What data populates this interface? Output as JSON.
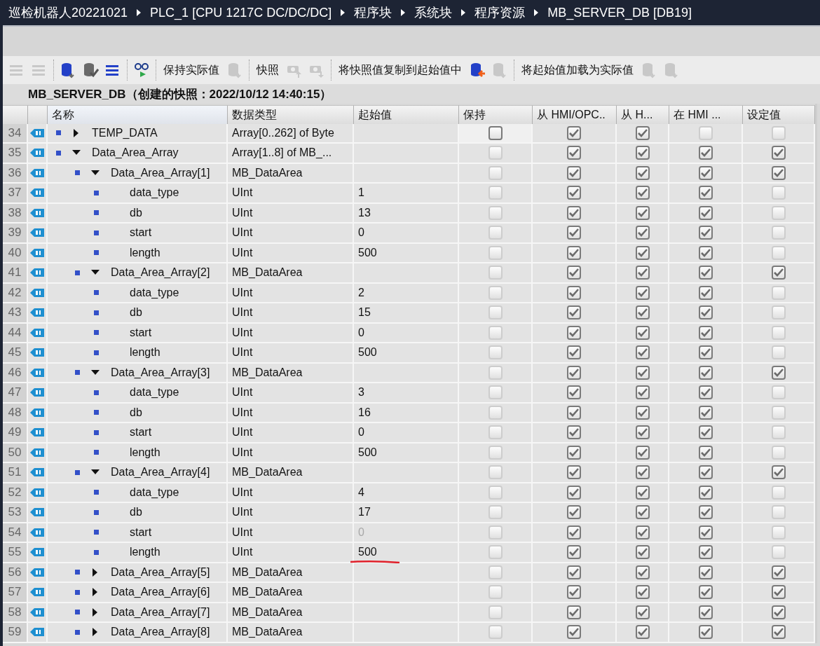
{
  "breadcrumb": [
    "巡检机器人20221021",
    "PLC_1 [CPU 1217C DC/DC/DC]",
    "程序块",
    "系统块",
    "程序资源",
    "MB_SERVER_DB [DB19]"
  ],
  "toolbar": [
    {
      "kind": "icon",
      "disabled": true
    },
    {
      "kind": "icon",
      "disabled": true
    },
    {
      "kind": "separator"
    },
    {
      "kind": "icon",
      "disabled": false
    },
    {
      "kind": "icon",
      "disabled": false
    },
    {
      "kind": "icon",
      "disabled": false
    },
    {
      "kind": "separator"
    },
    {
      "kind": "icon",
      "disabled": false
    },
    {
      "kind": "separator"
    },
    {
      "kind": "label",
      "text": "保持实际值"
    },
    {
      "kind": "icon",
      "disabled": true
    },
    {
      "kind": "separator"
    },
    {
      "kind": "label",
      "text": "快照"
    },
    {
      "kind": "icon",
      "disabled": true
    },
    {
      "kind": "icon",
      "disabled": true
    },
    {
      "kind": "separator"
    },
    {
      "kind": "label",
      "text": "将快照值复制到起始值中"
    },
    {
      "kind": "icon",
      "disabled": false
    },
    {
      "kind": "icon",
      "disabled": true
    },
    {
      "kind": "separator"
    },
    {
      "kind": "label",
      "text": "将起始值加载为实际值"
    },
    {
      "kind": "icon",
      "disabled": true
    },
    {
      "kind": "icon",
      "disabled": true
    }
  ],
  "block_title": "MB_SERVER_DB（创建的快照：2022/10/12 14:40:15）",
  "columns": [
    "名称",
    "数据类型",
    "起始值",
    "保持",
    "从 HMI/OPC..",
    "从 H...",
    "在 HMI ...",
    "设定值"
  ],
  "rows": [
    {
      "line": "34",
      "name": "TEMP_DATA",
      "type": "Array[0..262] of Byte",
      "expanded": false,
      "checks": [
        {
          "checked": false,
          "disabled": false
        },
        {
          "checked": true,
          "disabled": false
        },
        {
          "checked": true,
          "disabled": false
        },
        {
          "checked": false,
          "disabled": true
        },
        {
          "checked": false,
          "disabled": true
        }
      ]
    },
    {
      "line": "35",
      "name": "Data_Area_Array",
      "type": "Array[1..8] of MB_...",
      "expanded": true,
      "checks": [
        {
          "checked": false,
          "disabled": true
        },
        {
          "checked": true,
          "disabled": false
        },
        {
          "checked": true,
          "disabled": false
        },
        {
          "checked": true,
          "disabled": false
        },
        {
          "checked": true,
          "disabled": false
        }
      ],
      "children": [
        {
          "line": "36",
          "name": "Data_Area_Array[1]",
          "type": "MB_DataArea",
          "expanded": true,
          "checks": [
            {
              "checked": false,
              "disabled": true
            },
            {
              "checked": true,
              "disabled": false
            },
            {
              "checked": true,
              "disabled": false
            },
            {
              "checked": true,
              "disabled": false
            },
            {
              "checked": true,
              "disabled": false
            }
          ],
          "children": [
            {
              "line": "37",
              "name": "data_type",
              "type": "UInt",
              "start": "1",
              "checks": [
                {
                  "checked": false,
                  "disabled": true
                },
                {
                  "checked": true,
                  "disabled": false
                },
                {
                  "checked": true,
                  "disabled": false
                },
                {
                  "checked": true,
                  "disabled": false
                },
                {
                  "checked": false,
                  "disabled": true
                }
              ]
            },
            {
              "line": "38",
              "name": "db",
              "type": "UInt",
              "start": "13",
              "checks": [
                {
                  "checked": false,
                  "disabled": true
                },
                {
                  "checked": true,
                  "disabled": false
                },
                {
                  "checked": true,
                  "disabled": false
                },
                {
                  "checked": true,
                  "disabled": false
                },
                {
                  "checked": false,
                  "disabled": true
                }
              ]
            },
            {
              "line": "39",
              "name": "start",
              "type": "UInt",
              "start": "0",
              "checks": [
                {
                  "checked": false,
                  "disabled": true
                },
                {
                  "checked": true,
                  "disabled": false
                },
                {
                  "checked": true,
                  "disabled": false
                },
                {
                  "checked": true,
                  "disabled": false
                },
                {
                  "checked": false,
                  "disabled": true
                }
              ]
            },
            {
              "line": "40",
              "name": "length",
              "type": "UInt",
              "start": "500",
              "checks": [
                {
                  "checked": false,
                  "disabled": true
                },
                {
                  "checked": true,
                  "disabled": false
                },
                {
                  "checked": true,
                  "disabled": false
                },
                {
                  "checked": true,
                  "disabled": false
                },
                {
                  "checked": false,
                  "disabled": true
                }
              ]
            }
          ]
        },
        {
          "line": "41",
          "name": "Data_Area_Array[2]",
          "type": "MB_DataArea",
          "expanded": true,
          "checks": [
            {
              "checked": false,
              "disabled": true
            },
            {
              "checked": true,
              "disabled": false
            },
            {
              "checked": true,
              "disabled": false
            },
            {
              "checked": true,
              "disabled": false
            },
            {
              "checked": true,
              "disabled": false
            }
          ],
          "children": [
            {
              "line": "42",
              "name": "data_type",
              "type": "UInt",
              "start": "2",
              "checks": [
                {
                  "checked": false,
                  "disabled": true
                },
                {
                  "checked": true,
                  "disabled": false
                },
                {
                  "checked": true,
                  "disabled": false
                },
                {
                  "checked": true,
                  "disabled": false
                },
                {
                  "checked": false,
                  "disabled": true
                }
              ]
            },
            {
              "line": "43",
              "name": "db",
              "type": "UInt",
              "start": "15",
              "checks": [
                {
                  "checked": false,
                  "disabled": true
                },
                {
                  "checked": true,
                  "disabled": false
                },
                {
                  "checked": true,
                  "disabled": false
                },
                {
                  "checked": true,
                  "disabled": false
                },
                {
                  "checked": false,
                  "disabled": true
                }
              ]
            },
            {
              "line": "44",
              "name": "start",
              "type": "UInt",
              "start": "0",
              "checks": [
                {
                  "checked": false,
                  "disabled": true
                },
                {
                  "checked": true,
                  "disabled": false
                },
                {
                  "checked": true,
                  "disabled": false
                },
                {
                  "checked": true,
                  "disabled": false
                },
                {
                  "checked": false,
                  "disabled": true
                }
              ]
            },
            {
              "line": "45",
              "name": "length",
              "type": "UInt",
              "start": "500",
              "checks": [
                {
                  "checked": false,
                  "disabled": true
                },
                {
                  "checked": true,
                  "disabled": false
                },
                {
                  "checked": true,
                  "disabled": false
                },
                {
                  "checked": true,
                  "disabled": false
                },
                {
                  "checked": false,
                  "disabled": true
                }
              ]
            }
          ]
        },
        {
          "line": "46",
          "name": "Data_Area_Array[3]",
          "type": "MB_DataArea",
          "expanded": true,
          "checks": [
            {
              "checked": false,
              "disabled": true
            },
            {
              "checked": true,
              "disabled": false
            },
            {
              "checked": true,
              "disabled": false
            },
            {
              "checked": true,
              "disabled": false
            },
            {
              "checked": true,
              "disabled": false
            }
          ],
          "children": [
            {
              "line": "47",
              "name": "data_type",
              "type": "UInt",
              "start": "3",
              "checks": [
                {
                  "checked": false,
                  "disabled": true
                },
                {
                  "checked": true,
                  "disabled": false
                },
                {
                  "checked": true,
                  "disabled": false
                },
                {
                  "checked": true,
                  "disabled": false
                },
                {
                  "checked": false,
                  "disabled": true
                }
              ]
            },
            {
              "line": "48",
              "name": "db",
              "type": "UInt",
              "start": "16",
              "checks": [
                {
                  "checked": false,
                  "disabled": true
                },
                {
                  "checked": true,
                  "disabled": false
                },
                {
                  "checked": true,
                  "disabled": false
                },
                {
                  "checked": true,
                  "disabled": false
                },
                {
                  "checked": false,
                  "disabled": true
                }
              ]
            },
            {
              "line": "49",
              "name": "start",
              "type": "UInt",
              "start": "0",
              "checks": [
                {
                  "checked": false,
                  "disabled": true
                },
                {
                  "checked": true,
                  "disabled": false
                },
                {
                  "checked": true,
                  "disabled": false
                },
                {
                  "checked": true,
                  "disabled": false
                },
                {
                  "checked": false,
                  "disabled": true
                }
              ]
            },
            {
              "line": "50",
              "name": "length",
              "type": "UInt",
              "start": "500",
              "checks": [
                {
                  "checked": false,
                  "disabled": true
                },
                {
                  "checked": true,
                  "disabled": false
                },
                {
                  "checked": true,
                  "disabled": false
                },
                {
                  "checked": true,
                  "disabled": false
                },
                {
                  "checked": false,
                  "disabled": true
                }
              ]
            }
          ]
        },
        {
          "line": "51",
          "name": "Data_Area_Array[4]",
          "type": "MB_DataArea",
          "expanded": true,
          "checks": [
            {
              "checked": false,
              "disabled": true
            },
            {
              "checked": true,
              "disabled": false
            },
            {
              "checked": true,
              "disabled": false
            },
            {
              "checked": true,
              "disabled": false
            },
            {
              "checked": true,
              "disabled": false
            }
          ],
          "children": [
            {
              "line": "52",
              "name": "data_type",
              "type": "UInt",
              "start": "4",
              "checks": [
                {
                  "checked": false,
                  "disabled": true
                },
                {
                  "checked": true,
                  "disabled": false
                },
                {
                  "checked": true,
                  "disabled": false
                },
                {
                  "checked": true,
                  "disabled": false
                },
                {
                  "checked": false,
                  "disabled": true
                }
              ]
            },
            {
              "line": "53",
              "name": "db",
              "type": "UInt",
              "start": "17",
              "checks": [
                {
                  "checked": false,
                  "disabled": true
                },
                {
                  "checked": true,
                  "disabled": false
                },
                {
                  "checked": true,
                  "disabled": false
                },
                {
                  "checked": true,
                  "disabled": false
                },
                {
                  "checked": false,
                  "disabled": true
                }
              ]
            },
            {
              "line": "54",
              "name": "start",
              "type": "UInt",
              "start": "0",
              "greyed": true,
              "checks": [
                {
                  "checked": false,
                  "disabled": true
                },
                {
                  "checked": true,
                  "disabled": false
                },
                {
                  "checked": true,
                  "disabled": false
                },
                {
                  "checked": true,
                  "disabled": false
                },
                {
                  "checked": false,
                  "disabled": true
                }
              ]
            },
            {
              "line": "55",
              "name": "length",
              "type": "UInt",
              "start": "500",
              "underlined": true,
              "checks": [
                {
                  "checked": false,
                  "disabled": true
                },
                {
                  "checked": true,
                  "disabled": false
                },
                {
                  "checked": true,
                  "disabled": false
                },
                {
                  "checked": true,
                  "disabled": false
                },
                {
                  "checked": false,
                  "disabled": true
                }
              ]
            }
          ]
        },
        {
          "line": "56",
          "name": "Data_Area_Array[5]",
          "type": "MB_DataArea",
          "expanded": false,
          "checks": [
            {
              "checked": false,
              "disabled": true
            },
            {
              "checked": true,
              "disabled": false
            },
            {
              "checked": true,
              "disabled": false
            },
            {
              "checked": true,
              "disabled": false
            },
            {
              "checked": true,
              "disabled": false
            }
          ]
        },
        {
          "line": "57",
          "name": "Data_Area_Array[6]",
          "type": "MB_DataArea",
          "expanded": false,
          "checks": [
            {
              "checked": false,
              "disabled": true
            },
            {
              "checked": true,
              "disabled": false
            },
            {
              "checked": true,
              "disabled": false
            },
            {
              "checked": true,
              "disabled": false
            },
            {
              "checked": true,
              "disabled": false
            }
          ]
        },
        {
          "line": "58",
          "name": "Data_Area_Array[7]",
          "type": "MB_DataArea",
          "expanded": false,
          "checks": [
            {
              "checked": false,
              "disabled": true
            },
            {
              "checked": true,
              "disabled": false
            },
            {
              "checked": true,
              "disabled": false
            },
            {
              "checked": true,
              "disabled": false
            },
            {
              "checked": true,
              "disabled": false
            }
          ]
        },
        {
          "line": "59",
          "name": "Data_Area_Array[8]",
          "type": "MB_DataArea",
          "expanded": false,
          "checks": [
            {
              "checked": false,
              "disabled": true
            },
            {
              "checked": true,
              "disabled": false
            },
            {
              "checked": true,
              "disabled": false
            },
            {
              "checked": true,
              "disabled": false
            },
            {
              "checked": true,
              "disabled": false
            }
          ]
        }
      ]
    }
  ]
}
